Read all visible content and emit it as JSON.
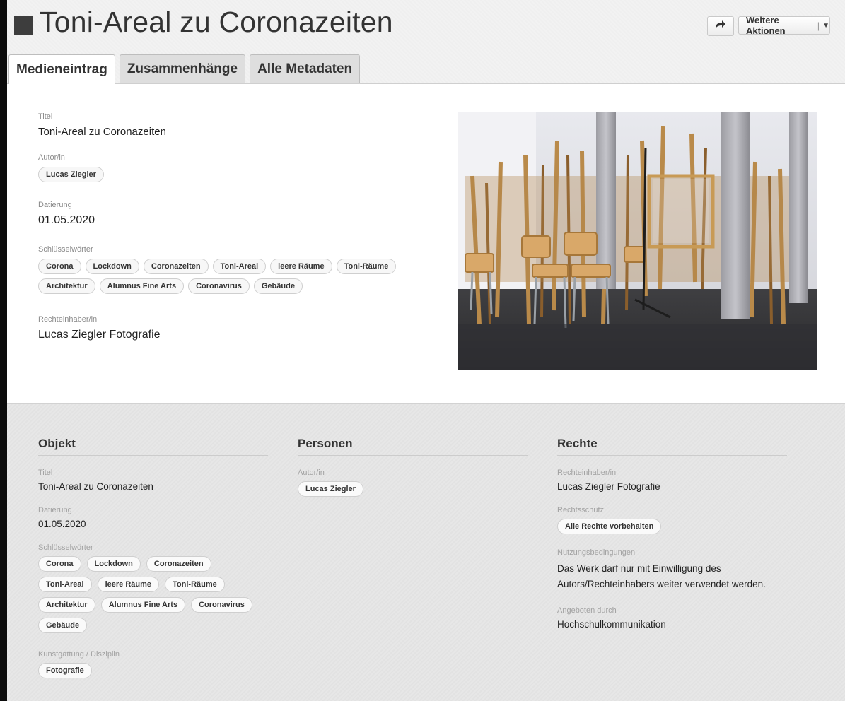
{
  "header": {
    "title": "Toni-Areal zu Coronazeiten",
    "more_actions": "Weitere Aktionen",
    "share_icon": "share-arrow-icon"
  },
  "tabs": [
    {
      "label": "Medieneintrag",
      "active": true
    },
    {
      "label": "Zusammenhänge",
      "active": false
    },
    {
      "label": "Alle Metadaten",
      "active": false
    }
  ],
  "summary": {
    "title_label": "Titel",
    "title": "Toni-Areal zu Coronazeiten",
    "author_label": "Autor/in",
    "author": "Lucas Ziegler",
    "date_label": "Datierung",
    "date": "01.05.2020",
    "keywords_label": "Schlüsselwörter",
    "keywords": [
      "Corona",
      "Lockdown",
      "Coronazeiten",
      "Toni-Areal",
      "leere Räume",
      "Toni-Räume",
      "Architektur",
      "Alumnus Fine Arts",
      "Coronavirus",
      "Gebäude"
    ],
    "rights_holder_label": "Rechteinhaber/in",
    "rights_holder": "Lucas Ziegler Fotografie"
  },
  "objekt": {
    "heading": "Objekt",
    "title_label": "Titel",
    "title": "Toni-Areal zu Coronazeiten",
    "date_label": "Datierung",
    "date": "01.05.2020",
    "keywords_label": "Schlüsselwörter",
    "keywords": [
      "Corona",
      "Lockdown",
      "Coronazeiten",
      "Toni-Areal",
      "leere Räume",
      "Toni-Räume",
      "Architektur",
      "Alumnus Fine Arts",
      "Coronavirus",
      "Gebäude"
    ],
    "genre_label": "Kunstgattung / Disziplin",
    "genre": "Fotografie"
  },
  "personen": {
    "heading": "Personen",
    "author_label": "Autor/in",
    "author": "Lucas Ziegler"
  },
  "rechte": {
    "heading": "Rechte",
    "holder_label": "Rechteinhaber/in",
    "holder": "Lucas Ziegler Fotografie",
    "protection_label": "Rechtsschutz",
    "protection": "Alle Rechte vorbehalten",
    "terms_label": "Nutzungsbedingungen",
    "terms": "Das Werk darf nur mit Einwilligung des Autors/Rechteinhabers weiter verwendet werden.",
    "offered_label": "Angeboten durch",
    "offered": "Hochschulkommunikation"
  }
}
